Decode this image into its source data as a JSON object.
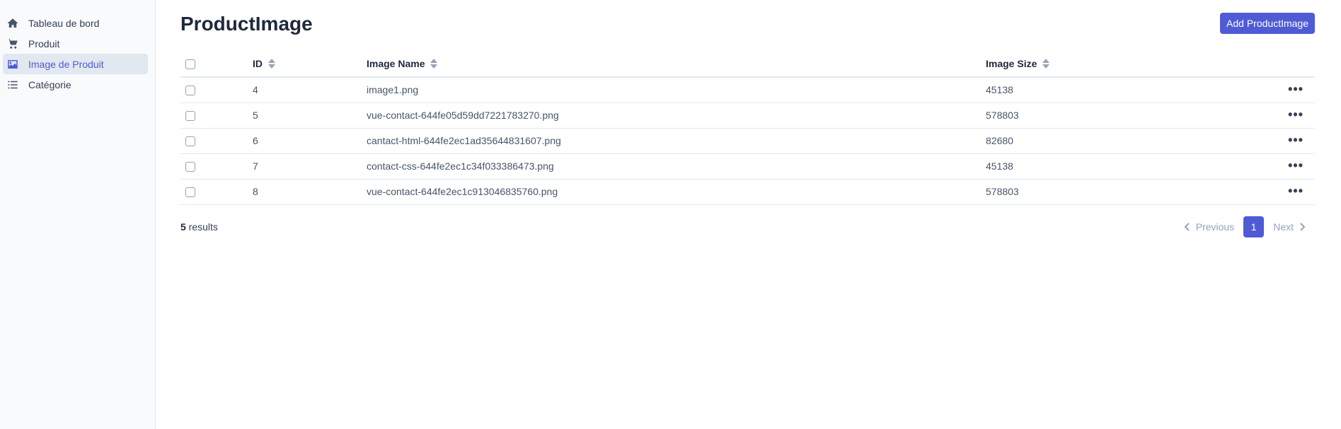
{
  "sidebar": {
    "items": [
      {
        "label": "Tableau de bord",
        "icon": "home-icon",
        "active": false
      },
      {
        "label": "Produit",
        "icon": "cart-icon",
        "active": false
      },
      {
        "label": "Image de Produit",
        "icon": "image-icon",
        "active": true
      },
      {
        "label": "Catégorie",
        "icon": "list-icon",
        "active": false
      }
    ]
  },
  "header": {
    "title": "ProductImage",
    "add_button_label": "Add ProductImage"
  },
  "table": {
    "columns": [
      "ID",
      "Image Name",
      "Image Size"
    ],
    "rows": [
      {
        "id": "4",
        "name": "image1.png",
        "size": "45138"
      },
      {
        "id": "5",
        "name": "vue-contact-644fe05d59dd7221783270.png",
        "size": "578803"
      },
      {
        "id": "6",
        "name": "cantact-html-644fe2ec1ad35644831607.png",
        "size": "82680"
      },
      {
        "id": "7",
        "name": "contact-css-644fe2ec1c34f033386473.png",
        "size": "45138"
      },
      {
        "id": "8",
        "name": "vue-contact-644fe2ec1c913046835760.png",
        "size": "578803"
      }
    ],
    "row_action_label": "•••"
  },
  "footer": {
    "results_count": "5",
    "results_label": " results"
  },
  "pagination": {
    "previous_label": "Previous",
    "current_page": "1",
    "next_label": "Next"
  },
  "colors": {
    "accent": "#4f5bd5",
    "sidebar_bg": "#f8fafc",
    "active_bg": "#e2e8f0"
  }
}
